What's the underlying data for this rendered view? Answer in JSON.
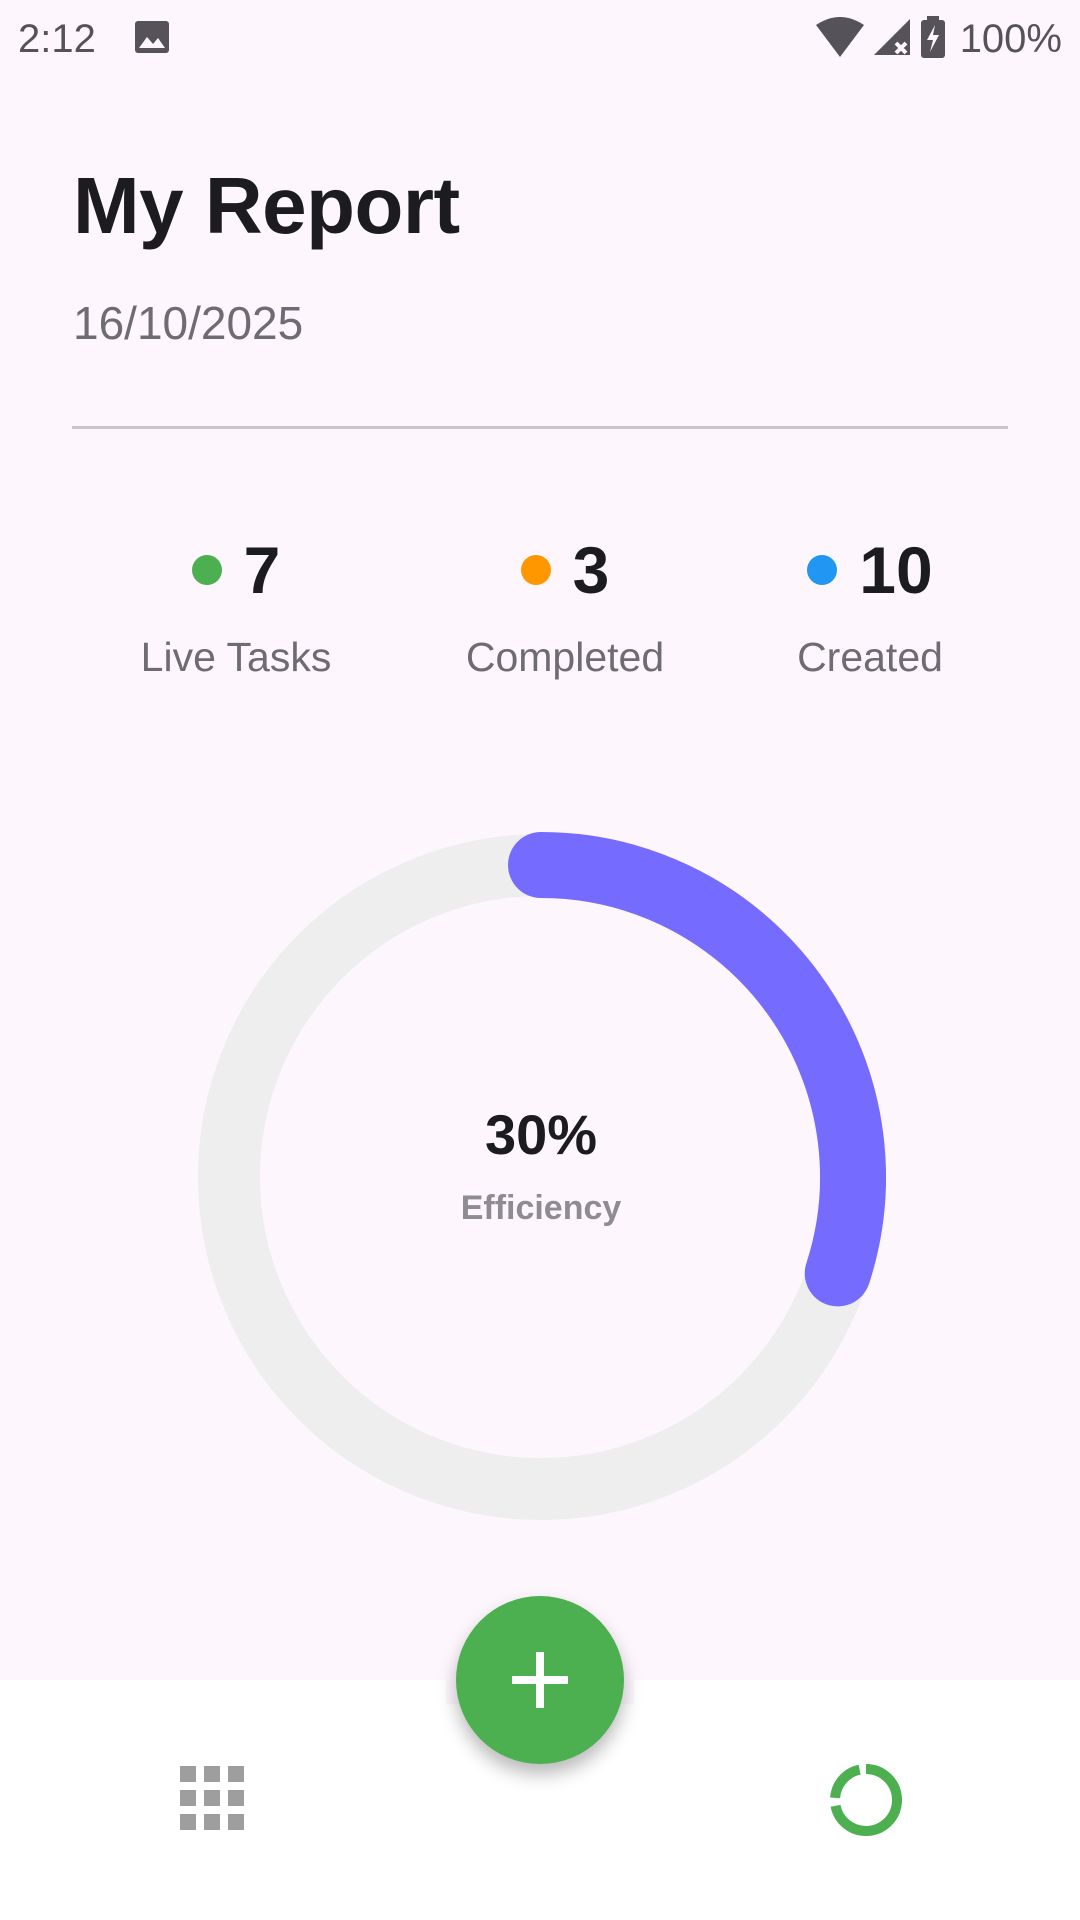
{
  "status_bar": {
    "time": "2:12",
    "battery": "100%",
    "icons": [
      "image-icon",
      "wifi-icon",
      "signal-icon",
      "battery-charging-icon"
    ]
  },
  "header": {
    "title": "My Report",
    "date": "16/10/2025"
  },
  "stats": [
    {
      "value": "7",
      "label": "Live Tasks",
      "color": "#4CAF50"
    },
    {
      "value": "3",
      "label": "Completed",
      "color": "#FF9800"
    },
    {
      "value": "10",
      "label": "Created",
      "color": "#2196F3"
    }
  ],
  "efficiency": {
    "value": "30%",
    "label": "Efficiency",
    "fraction": 0.3,
    "progress_color": "#756CFF",
    "track_color": "#EEEEEE"
  },
  "bottom_nav": {
    "fab_icon": "plus-icon",
    "fab_color": "#4CAF50",
    "items": [
      {
        "icon": "grid-icon",
        "active": false,
        "color": "#9E9E9E"
      },
      {
        "icon": "report-donut-icon",
        "active": true,
        "color": "#4CAF50"
      }
    ]
  }
}
